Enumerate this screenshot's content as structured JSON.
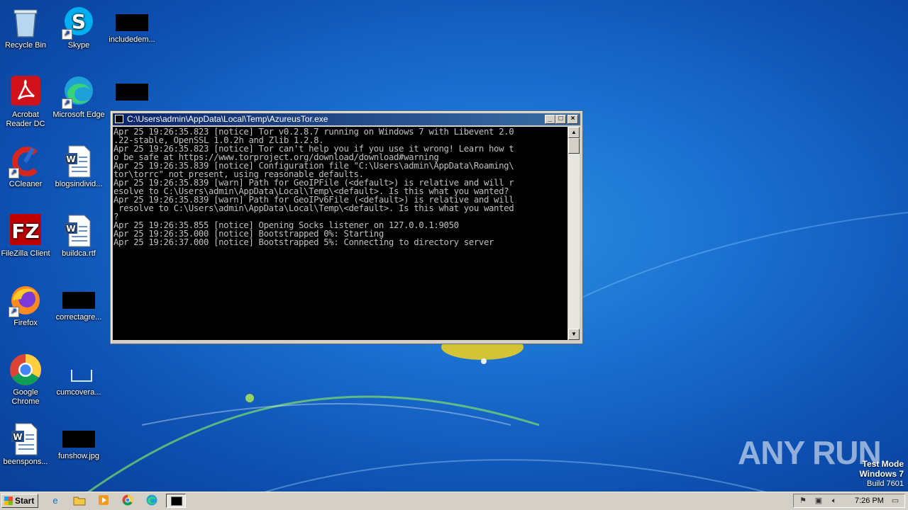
{
  "desktop": {
    "icons": [
      {
        "label": "Recycle Bin",
        "icon": "recycle-bin-icon"
      },
      {
        "label": "Skype",
        "icon": "skype-icon"
      },
      {
        "label": "includedem...",
        "icon": "file-icon"
      },
      {
        "label": "Acrobat Reader DC",
        "icon": "acrobat-icon"
      },
      {
        "label": "Microsoft Edge",
        "icon": "edge-icon"
      },
      {
        "label": "CCleaner",
        "icon": "ccleaner-icon"
      },
      {
        "label": "blogsindivid...",
        "icon": "word-doc-icon"
      },
      {
        "label": "FileZilla Client",
        "icon": "filezilla-icon"
      },
      {
        "label": "buildca.rtf",
        "icon": "word-doc-icon"
      },
      {
        "label": "Firefox",
        "icon": "firefox-icon"
      },
      {
        "label": "correctagre...",
        "icon": "file-icon"
      },
      {
        "label": "Google Chrome",
        "icon": "chrome-icon"
      },
      {
        "label": "cumcovera...",
        "icon": "file-icon"
      },
      {
        "label": "beenspons...",
        "icon": "word-doc-icon"
      },
      {
        "label": "funshow.jpg",
        "icon": "image-file-icon"
      }
    ]
  },
  "console": {
    "title": "C:\\Users\\admin\\AppData\\Local\\Temp\\AzureusTor.exe",
    "lines": [
      "Apr 25 19:26:35.823 [notice] Tor v0.2.8.7 running on Windows 7 with Libevent 2.0",
      ".22-stable, OpenSSL 1.0.2h and Zlib 1.2.8.",
      "Apr 25 19:26:35.823 [notice] Tor can't help you if you use it wrong! Learn how t",
      "o be safe at https://www.torproject.org/download/download#warning",
      "Apr 25 19:26:35.839 [notice] Configuration file \"C:\\Users\\admin\\AppData\\Roaming\\",
      "tor\\torrc\" not present, using reasonable defaults.",
      "Apr 25 19:26:35.839 [warn] Path for GeoIPFile (<default>) is relative and will r",
      "esolve to C:\\Users\\admin\\AppData\\Local\\Temp\\<default>. Is this what you wanted?",
      "Apr 25 19:26:35.839 [warn] Path for GeoIPv6File (<default>) is relative and will",
      " resolve to C:\\Users\\admin\\AppData\\Local\\Temp\\<default>. Is this what you wanted",
      "?",
      "Apr 25 19:26:35.855 [notice] Opening Socks listener on 127.0.0.1:9050",
      "Apr 25 19:26:35.000 [notice] Bootstrapped 0%: Starting",
      "Apr 25 19:26:37.000 [notice] Bootstrapped 5%: Connecting to directory server"
    ]
  },
  "watermark": "ANY RUN",
  "test_mode": {
    "line1": "Test Mode",
    "line2": "Windows 7",
    "line3": "Build 7601"
  },
  "taskbar": {
    "start_label": "Start",
    "clock": "7:26 PM"
  }
}
